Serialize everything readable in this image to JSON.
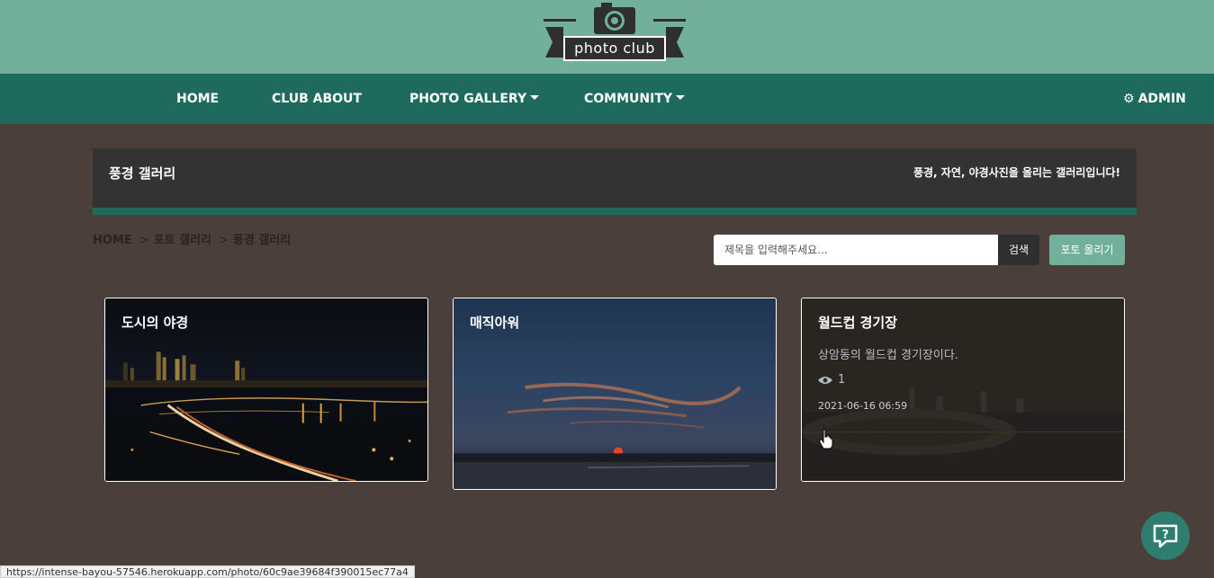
{
  "brand": {
    "logo_text": "photo club"
  },
  "nav": {
    "home": "HOME",
    "club_about": "CLUB ABOUT",
    "photo_gallery": "PHOTO GALLERY",
    "community": "COMMUNITY",
    "admin": "ADMIN"
  },
  "gallery_header": {
    "title": "풍경 갤러리",
    "description": "풍경, 자연, 야경사진을 올리는 갤러리입니다!"
  },
  "breadcrumb": [
    "HOME",
    "포토 갤러리",
    "풍경 갤러리"
  ],
  "search": {
    "placeholder": "제목을 입력해주세요...",
    "button_label": "검색"
  },
  "upload_button_label": "포토 올리기",
  "cards": [
    {
      "title": "도시의 야경"
    },
    {
      "title": "매직아워"
    },
    {
      "title": "월드컵 경기장",
      "text": "상암동의 월드컵 경기장이다.",
      "views": "1",
      "date": "2021-06-16 06:59"
    }
  ],
  "status_bar": {
    "url": "https://intense-bayou-57546.herokuapp.com/photo/60c9ae39684f390015ec77a4"
  },
  "colors": {
    "banner": "#72b09c",
    "navbar": "#1e6b5e",
    "page_bg": "#4a3f3a",
    "header_box": "#333333",
    "accent": "#72b09c"
  },
  "icons": {
    "admin": "gear-icon",
    "views": "eye-icon",
    "help": "question-icon",
    "logo": "camera-icon"
  }
}
